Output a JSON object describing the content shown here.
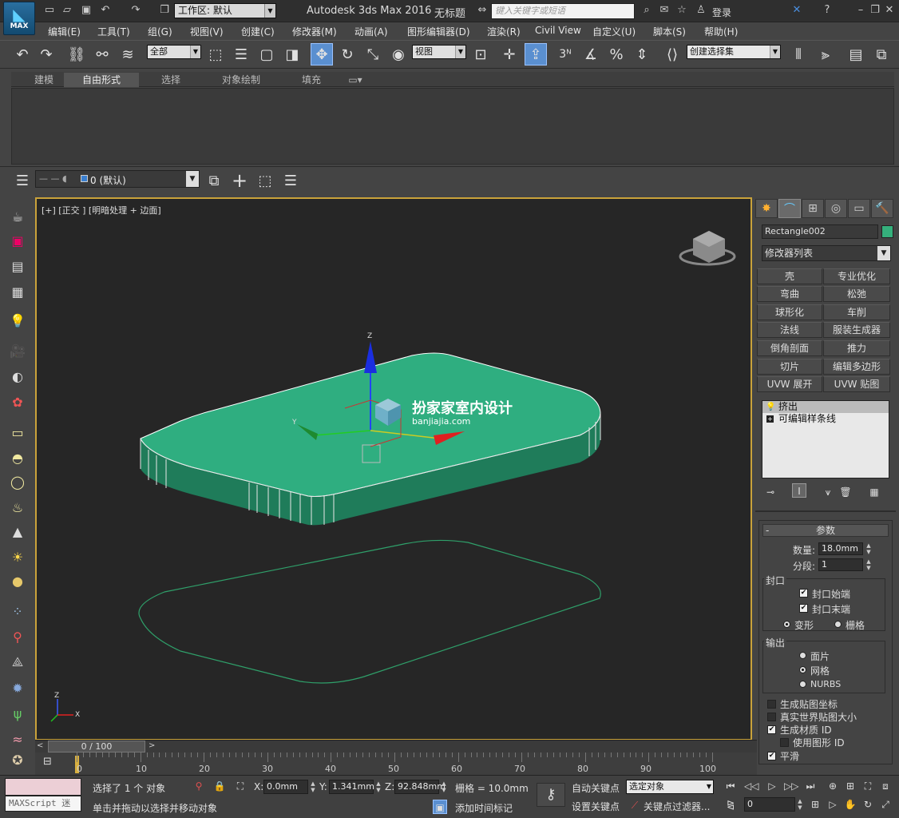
{
  "title_bar": {
    "logo_text": "MAX",
    "workspace_label": "工作区: 默认",
    "app_title": "Autodesk 3ds Max 2016",
    "doc_title": "无标题",
    "search_placeholder": "键入关键字或短语",
    "login": "登录"
  },
  "menu": [
    "编辑(E)",
    "工具(T)",
    "组(G)",
    "视图(V)",
    "创建(C)",
    "修改器(M)",
    "动画(A)",
    "图形编辑器(D)",
    "渲染(R)",
    "Civil View",
    "自定义(U)",
    "脚本(S)",
    "帮助(H)"
  ],
  "toolbar": {
    "selection_filter": "全部",
    "ref_coord": "视图",
    "snap_3": "3",
    "named_selection": "创建选择集"
  },
  "ribbon_tabs": [
    "建模",
    "自由形式",
    "选择",
    "对象绘制",
    "填充"
  ],
  "layer": {
    "current": "0 (默认)"
  },
  "viewport": {
    "label": "[+] [正交 ] [明暗处理 + 边面]",
    "watermark_title": "扮家家室内设计",
    "watermark_url": "banjiajia.com",
    "axis_labels": {
      "z": "Z",
      "x": "X",
      "y": "Y"
    },
    "mesh_color": "#2fae80",
    "spline_color": "#2fa06a"
  },
  "command_panel": {
    "object_name": "Rectangle002",
    "object_color": "#35b07c",
    "modifier_list": "修改器列表",
    "modifier_buttons": [
      [
        "壳",
        "专业优化"
      ],
      [
        "弯曲",
        "松弛"
      ],
      [
        "球形化",
        "车削"
      ],
      [
        "法线",
        "服装生成器"
      ],
      [
        "倒角剖面",
        "推力"
      ],
      [
        "切片",
        "编辑多边形"
      ],
      [
        "UVW 展开",
        "UVW 贴图"
      ]
    ],
    "stack": [
      "挤出",
      "可编辑样条线"
    ],
    "params": {
      "title": "参数",
      "amount_label": "数量:",
      "amount_value": "18.0mm",
      "segments_label": "分段:",
      "segments_value": "1",
      "capping_label": "封口",
      "cap_start": "封口始端",
      "cap_end": "封口末端",
      "morph": "变形",
      "grid": "栅格",
      "output_label": "输出",
      "patch": "面片",
      "mesh": "网格",
      "nurbs": "NURBS",
      "gen_mapping": "生成贴图坐标",
      "real_world": "真实世界贴图大小",
      "gen_mat_id": "生成材质 ID",
      "use_shape_id": "使用图形 ID",
      "smooth": "平滑"
    }
  },
  "timeline": {
    "frame": "0 / 100",
    "ticks": [
      "0",
      "10",
      "20",
      "30",
      "40",
      "50",
      "60",
      "70",
      "80",
      "90",
      "100"
    ],
    "current_frame_fraction": 0
  },
  "status": {
    "selected": "选择了 1 个 对象",
    "prompt": "单击并拖动以选择并移动对象",
    "x_label": "X:",
    "x_value": "0.0mm",
    "y_label": "Y:",
    "y_value": "1.341mm",
    "z_label": "Z:",
    "z_value": "92.848mm",
    "grid": "栅格 = 10.0mm",
    "add_time_tag": "添加时间标记",
    "auto_key": "自动关键点",
    "set_key": "设置关键点",
    "selected_obj": "选定对象",
    "key_filters": "关键点过滤器...",
    "frame_field": "0",
    "maxscript": "MAXScript 迷"
  }
}
